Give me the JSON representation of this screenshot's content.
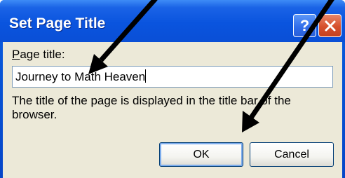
{
  "dialog": {
    "title": "Set Page Title",
    "help_glyph": "?",
    "label_accesskey": "P",
    "label_rest": "age title:",
    "input_value": "Journey to Math Heaven",
    "description": "The title of the page is displayed in the title bar of the browser.",
    "ok_label": "OK",
    "cancel_label": "Cancel"
  },
  "colors": {
    "titlebar": "#0a54de",
    "close_button": "#d6502c",
    "dialog_face": "#ece9d8",
    "annotation_arrow": "#000000"
  },
  "icons": [
    "help-icon",
    "close-icon"
  ]
}
